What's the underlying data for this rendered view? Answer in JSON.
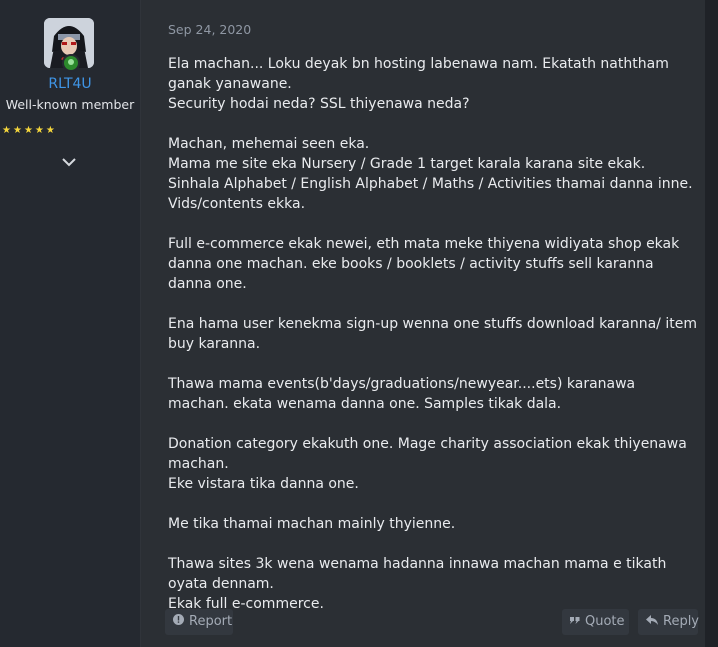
{
  "user": {
    "name": "RLT4U",
    "title": "Well-known member",
    "rating_stars": 5
  },
  "post": {
    "date": "Sep 24, 2020",
    "paragraphs": [
      [
        "Ela machan... Loku deyak bn hosting labenawa nam. Ekatath naththam ganak yanawane.",
        "Security hodai neda? SSL thiyenawa neda?"
      ],
      [
        "Machan, mehemai seen eka.",
        "Mama me site eka Nursery / Grade 1 target karala karana site ekak.",
        "Sinhala Alphabet / English Alphabet / Maths / Activities thamai danna inne.",
        "Vids/contents ekka."
      ],
      [
        "Full e-commerce ekak newei, eth mata meke thiyena widiyata shop ekak danna one machan. eke books / booklets / activity stuffs sell karanna danna one."
      ],
      [
        "Ena hama user kenekma sign-up wenna one stuffs download karanna/ item buy karanna."
      ],
      [
        "Thawa mama events(b'days/graduations/newyear....ets) karanawa machan. ekata wenama danna one. Samples tikak dala."
      ],
      [
        "Donation category ekakuth one. Mage charity association ekak thiyenawa machan.",
        "Eke vistara tika danna one."
      ],
      [
        "Me tika thamai machan mainly thyienne."
      ],
      [
        "Thawa sites 3k wena wenama hadanna innawa machan mama e tikath oyata dennam.",
        "Ekak full e-commerce."
      ]
    ]
  },
  "actions": {
    "report": "Report",
    "quote": "Quote",
    "reply": "Reply"
  },
  "colors": {
    "username": "#3f95e6",
    "star": "#f5d63c",
    "online": "#2c8a2c"
  }
}
